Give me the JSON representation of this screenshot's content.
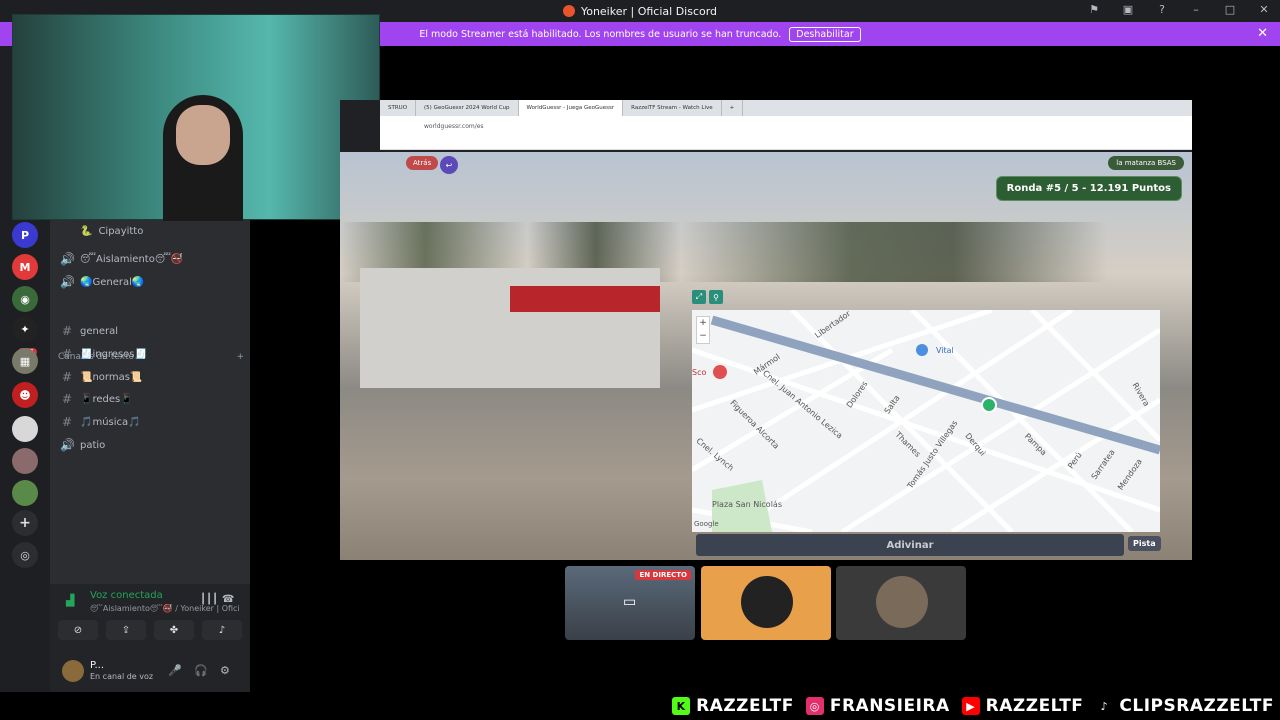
{
  "window": {
    "title": "Yoneiker | Oficial Discord"
  },
  "banner": {
    "text": "El modo Streamer está habilitado. Los nombres de usuario se han truncado.",
    "button": "Deshabilitar"
  },
  "servers": {
    "badge": "181"
  },
  "channels": {
    "voice_user": "Cipayitto",
    "voice_channels": [
      {
        "label": "😴Aislamiento😴🚭"
      },
      {
        "label": "🌏General🌏"
      }
    ],
    "section_title": "Canales de texto",
    "text_channels": [
      {
        "label": "general"
      },
      {
        "label": "🧾ingresos🧾"
      },
      {
        "label": "📜normas📜"
      },
      {
        "label": "📱redes📱"
      },
      {
        "label": "🎵música🎵"
      },
      {
        "label": "patio"
      }
    ]
  },
  "voice_panel": {
    "title": "Voz conectada",
    "subtitle": "😴Aislamiento😴🚭 / Yoneiker | Oficial...",
    "user_name": "P...",
    "user_status": "En canal de voz"
  },
  "browser": {
    "tabs": [
      {
        "label": "STRUO"
      },
      {
        "label": "(5) GeoGuessr 2024 World Cup"
      },
      {
        "label": "WorldGuessr - Juega GeoGuessr"
      },
      {
        "label": "RazzelTF Stream - Watch Live"
      }
    ],
    "url": "worldguessr.com/es"
  },
  "game": {
    "back_label": "Atrás",
    "room_tag": "la matanza BSAS",
    "round": "Ronda #5 / 5 - 12.191 Puntos",
    "guess_button": "Adivinar",
    "hint_button": "Pista",
    "map_labels": {
      "vital": "Vital",
      "plaza": "Plaza San Nicolás",
      "streets": [
        "Mármol",
        "Libertador",
        "Cnel. Juan Antonio Lezica",
        "Dolores",
        "Salta",
        "Thames",
        "Tomás Justo Villegas",
        "Derqui",
        "Pampa",
        "Perú",
        "Sarratea",
        "Mendoza",
        "Rivera",
        "Figueroa Alcorta",
        "Cnel. Lynch",
        "Sco"
      ],
      "google": "Google"
    }
  },
  "tiles": {
    "live_label": "EN DIRECTO"
  },
  "footer": {
    "items": [
      {
        "text": "RAZZELTF",
        "icon": "kick-icon",
        "color": "#53fc18"
      },
      {
        "text": "FRANSIEIRA",
        "icon": "instagram-icon",
        "color": "#e1306c"
      },
      {
        "text": "RAZZELTF",
        "icon": "youtube-icon",
        "color": "#ff0000"
      },
      {
        "text": "CLIPSRAZZELTF",
        "icon": "tiktok-icon",
        "color": "#ffffff"
      }
    ]
  },
  "colors": {
    "banner": "#a044f0",
    "discord_bg": "#2b2d31",
    "voice_green": "#23a55a"
  }
}
